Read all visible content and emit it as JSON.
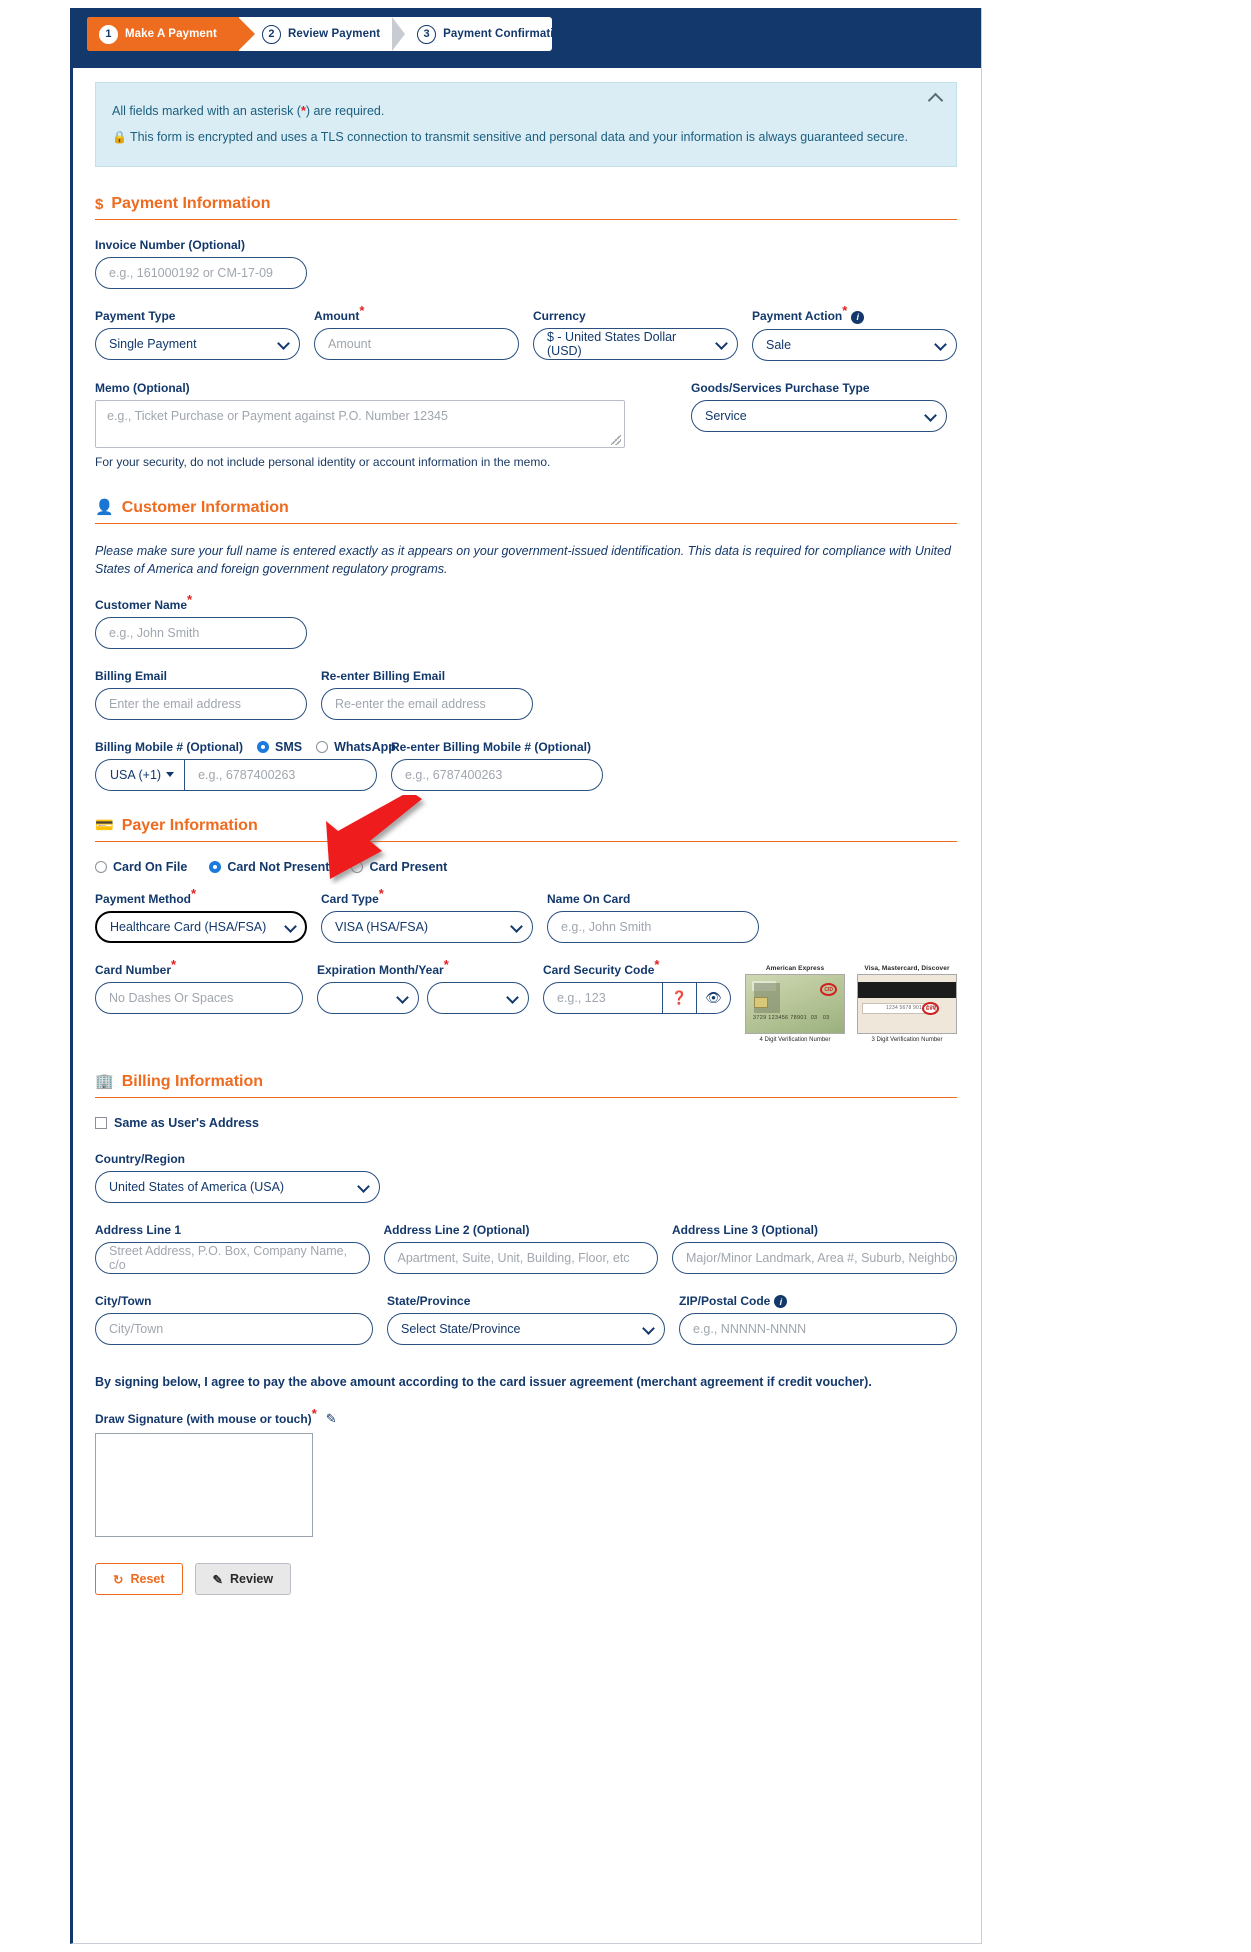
{
  "stepper": {
    "steps": [
      {
        "num": "1",
        "label": "Make A Payment",
        "active": true
      },
      {
        "num": "2",
        "label": "Review Payment",
        "active": false
      },
      {
        "num": "3",
        "label": "Payment Confirmation",
        "active": false
      }
    ]
  },
  "notice": {
    "required_text_before": "All fields marked with an asterisk (",
    "required_asterisk": "*",
    "required_text_after": ") are required.",
    "security_text": "This form is encrypted and uses a TLS connection to transmit sensitive and personal data and your information is always guaranteed secure.",
    "lock_icon": "lock-icon",
    "collapse_icon": "chevron-up-icon"
  },
  "payment_information": {
    "heading": "Payment Information",
    "heading_icon": "dollar-icon",
    "invoice_number": {
      "label": "Invoice Number (Optional)",
      "placeholder": "e.g., 161000192 or CM-17-09",
      "value": ""
    },
    "payment_type": {
      "label": "Payment Type",
      "value": "Single Payment"
    },
    "amount": {
      "label": "Amount",
      "required": "*",
      "placeholder": "Amount",
      "value": ""
    },
    "currency": {
      "label": "Currency",
      "value": "$ - United States Dollar (USD)"
    },
    "payment_action": {
      "label": "Payment Action",
      "required": "*",
      "value": "Sale",
      "info_icon": "info-icon"
    },
    "memo": {
      "label": "Memo (Optional)",
      "placeholder": "e.g., Ticket Purchase or Payment against P.O. Number 12345",
      "value": ""
    },
    "memo_hint": "For your security, do not include personal identity or account information in the memo.",
    "goods_services": {
      "label": "Goods/Services Purchase Type",
      "value": "Service"
    }
  },
  "customer_information": {
    "heading": "Customer Information",
    "heading_icon": "person-icon",
    "intro": "Please make sure your full name is entered exactly as it appears on your government-issued identification. This data is required for compliance with United States of America and foreign government regulatory programs.",
    "customer_name": {
      "label": "Customer Name",
      "required": "*",
      "placeholder": "e.g., John Smith",
      "value": ""
    },
    "billing_email": {
      "label": "Billing Email",
      "placeholder": "Enter the email address",
      "value": ""
    },
    "reenter_billing_email": {
      "label": "Re-enter Billing Email",
      "placeholder": "Re-enter the email address",
      "value": ""
    },
    "billing_mobile": {
      "label": "Billing Mobile # (Optional)",
      "sms_label": "SMS",
      "whatsapp_label": "WhatsApp",
      "selected_channel": "SMS",
      "country_code": "USA (+1)",
      "placeholder": "e.g., 6787400263",
      "value": ""
    },
    "reenter_billing_mobile": {
      "label": "Re-enter Billing Mobile # (Optional)",
      "placeholder": "e.g., 6787400263",
      "value": ""
    }
  },
  "payer_information": {
    "heading": "Payer Information",
    "heading_icon": "credit-card-icon",
    "card_presence_options": [
      "Card On File",
      "Card Not Present",
      "Card Present"
    ],
    "card_presence_selected": "Card Not Present",
    "payment_method": {
      "label": "Payment Method",
      "required": "*",
      "value": "Healthcare Card (HSA/FSA)",
      "highlighted": true
    },
    "card_type": {
      "label": "Card Type",
      "required": "*",
      "value": "VISA (HSA/FSA)"
    },
    "name_on_card": {
      "label": "Name On Card",
      "placeholder": "e.g., John Smith",
      "value": ""
    },
    "card_number": {
      "label": "Card Number",
      "required": "*",
      "placeholder": "No Dashes Or Spaces",
      "value": ""
    },
    "expiration": {
      "label": "Expiration Month/Year",
      "required": "*",
      "month_value": "",
      "year_value": ""
    },
    "card_security_code": {
      "label": "Card Security Code",
      "required": "*",
      "placeholder": "e.g., 123",
      "value": "",
      "help_icon": "question-mark-icon",
      "show_icon": "eye-icon"
    },
    "card_samples": [
      {
        "title": "American Express",
        "caption": "4 Digit Verification Number",
        "cvv_tag": "CID"
      },
      {
        "title": "Visa, Mastercard, Discover",
        "caption": "3 Digit Verification Number",
        "cvv_tag": "CVV"
      }
    ]
  },
  "billing_information": {
    "heading": "Billing Information",
    "heading_icon": "building-icon",
    "same_as_user_address": {
      "label": "Same as User's Address",
      "checked": false
    },
    "country_region": {
      "label": "Country/Region",
      "value": "United States of America (USA)"
    },
    "address_line_1": {
      "label": "Address Line 1",
      "placeholder": "Street Address, P.O. Box, Company Name, c/o",
      "value": ""
    },
    "address_line_2": {
      "label": "Address Line 2 (Optional)",
      "placeholder": "Apartment, Suite, Unit, Building, Floor, etc",
      "value": ""
    },
    "address_line_3": {
      "label": "Address Line 3 (Optional)",
      "placeholder": "Major/Minor Landmark, Area #, Suburb, Neighborho",
      "value": ""
    },
    "city_town": {
      "label": "City/Town",
      "placeholder": "City/Town",
      "value": ""
    },
    "state_province": {
      "label": "State/Province",
      "value": "Select State/Province"
    },
    "zip_postal": {
      "label": "ZIP/Postal Code",
      "placeholder": "e.g., NNNNN-NNNN",
      "value": "",
      "info_icon": "info-icon"
    },
    "agreement": "By signing below, I agree to pay the above amount according to the card issuer agreement (merchant agreement if credit voucher).",
    "signature": {
      "label": "Draw Signature (with mouse or touch)",
      "required": "*",
      "erase_icon": "eraser-icon"
    }
  },
  "actions": {
    "reset": {
      "label": "Reset",
      "icon": "refresh-icon"
    },
    "review": {
      "label": "Review",
      "icon": "pencil-icon"
    }
  },
  "colors": {
    "brand_navy": "#13386b",
    "brand_orange": "#ee6b1f",
    "notice_bg": "#daedf4",
    "required_red": "#e02020",
    "annotation_red": "#ee1c1c"
  }
}
